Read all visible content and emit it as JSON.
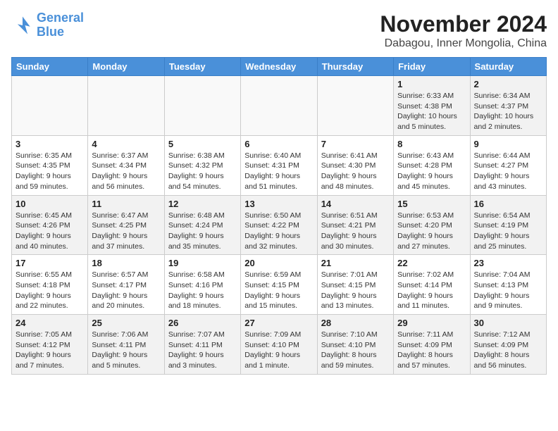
{
  "header": {
    "logo_line1": "General",
    "logo_line2": "Blue",
    "title": "November 2024",
    "subtitle": "Dabagou, Inner Mongolia, China"
  },
  "weekdays": [
    "Sunday",
    "Monday",
    "Tuesday",
    "Wednesday",
    "Thursday",
    "Friday",
    "Saturday"
  ],
  "weeks": [
    [
      {
        "day": "",
        "info": ""
      },
      {
        "day": "",
        "info": ""
      },
      {
        "day": "",
        "info": ""
      },
      {
        "day": "",
        "info": ""
      },
      {
        "day": "",
        "info": ""
      },
      {
        "day": "1",
        "info": "Sunrise: 6:33 AM\nSunset: 4:38 PM\nDaylight: 10 hours\nand 5 minutes."
      },
      {
        "day": "2",
        "info": "Sunrise: 6:34 AM\nSunset: 4:37 PM\nDaylight: 10 hours\nand 2 minutes."
      }
    ],
    [
      {
        "day": "3",
        "info": "Sunrise: 6:35 AM\nSunset: 4:35 PM\nDaylight: 9 hours\nand 59 minutes."
      },
      {
        "day": "4",
        "info": "Sunrise: 6:37 AM\nSunset: 4:34 PM\nDaylight: 9 hours\nand 56 minutes."
      },
      {
        "day": "5",
        "info": "Sunrise: 6:38 AM\nSunset: 4:32 PM\nDaylight: 9 hours\nand 54 minutes."
      },
      {
        "day": "6",
        "info": "Sunrise: 6:40 AM\nSunset: 4:31 PM\nDaylight: 9 hours\nand 51 minutes."
      },
      {
        "day": "7",
        "info": "Sunrise: 6:41 AM\nSunset: 4:30 PM\nDaylight: 9 hours\nand 48 minutes."
      },
      {
        "day": "8",
        "info": "Sunrise: 6:43 AM\nSunset: 4:28 PM\nDaylight: 9 hours\nand 45 minutes."
      },
      {
        "day": "9",
        "info": "Sunrise: 6:44 AM\nSunset: 4:27 PM\nDaylight: 9 hours\nand 43 minutes."
      }
    ],
    [
      {
        "day": "10",
        "info": "Sunrise: 6:45 AM\nSunset: 4:26 PM\nDaylight: 9 hours\nand 40 minutes."
      },
      {
        "day": "11",
        "info": "Sunrise: 6:47 AM\nSunset: 4:25 PM\nDaylight: 9 hours\nand 37 minutes."
      },
      {
        "day": "12",
        "info": "Sunrise: 6:48 AM\nSunset: 4:24 PM\nDaylight: 9 hours\nand 35 minutes."
      },
      {
        "day": "13",
        "info": "Sunrise: 6:50 AM\nSunset: 4:22 PM\nDaylight: 9 hours\nand 32 minutes."
      },
      {
        "day": "14",
        "info": "Sunrise: 6:51 AM\nSunset: 4:21 PM\nDaylight: 9 hours\nand 30 minutes."
      },
      {
        "day": "15",
        "info": "Sunrise: 6:53 AM\nSunset: 4:20 PM\nDaylight: 9 hours\nand 27 minutes."
      },
      {
        "day": "16",
        "info": "Sunrise: 6:54 AM\nSunset: 4:19 PM\nDaylight: 9 hours\nand 25 minutes."
      }
    ],
    [
      {
        "day": "17",
        "info": "Sunrise: 6:55 AM\nSunset: 4:18 PM\nDaylight: 9 hours\nand 22 minutes."
      },
      {
        "day": "18",
        "info": "Sunrise: 6:57 AM\nSunset: 4:17 PM\nDaylight: 9 hours\nand 20 minutes."
      },
      {
        "day": "19",
        "info": "Sunrise: 6:58 AM\nSunset: 4:16 PM\nDaylight: 9 hours\nand 18 minutes."
      },
      {
        "day": "20",
        "info": "Sunrise: 6:59 AM\nSunset: 4:15 PM\nDaylight: 9 hours\nand 15 minutes."
      },
      {
        "day": "21",
        "info": "Sunrise: 7:01 AM\nSunset: 4:15 PM\nDaylight: 9 hours\nand 13 minutes."
      },
      {
        "day": "22",
        "info": "Sunrise: 7:02 AM\nSunset: 4:14 PM\nDaylight: 9 hours\nand 11 minutes."
      },
      {
        "day": "23",
        "info": "Sunrise: 7:04 AM\nSunset: 4:13 PM\nDaylight: 9 hours\nand 9 minutes."
      }
    ],
    [
      {
        "day": "24",
        "info": "Sunrise: 7:05 AM\nSunset: 4:12 PM\nDaylight: 9 hours\nand 7 minutes."
      },
      {
        "day": "25",
        "info": "Sunrise: 7:06 AM\nSunset: 4:11 PM\nDaylight: 9 hours\nand 5 minutes."
      },
      {
        "day": "26",
        "info": "Sunrise: 7:07 AM\nSunset: 4:11 PM\nDaylight: 9 hours\nand 3 minutes."
      },
      {
        "day": "27",
        "info": "Sunrise: 7:09 AM\nSunset: 4:10 PM\nDaylight: 9 hours\nand 1 minute."
      },
      {
        "day": "28",
        "info": "Sunrise: 7:10 AM\nSunset: 4:10 PM\nDaylight: 8 hours\nand 59 minutes."
      },
      {
        "day": "29",
        "info": "Sunrise: 7:11 AM\nSunset: 4:09 PM\nDaylight: 8 hours\nand 57 minutes."
      },
      {
        "day": "30",
        "info": "Sunrise: 7:12 AM\nSunset: 4:09 PM\nDaylight: 8 hours\nand 56 minutes."
      }
    ]
  ]
}
